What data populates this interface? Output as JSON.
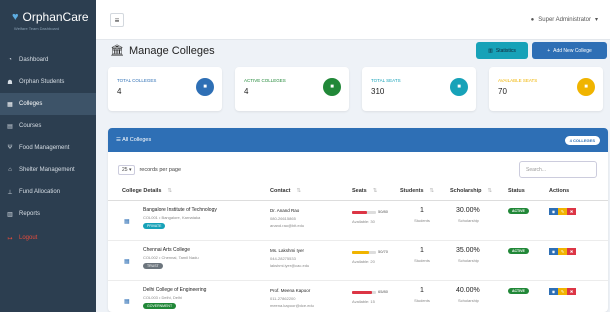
{
  "app": {
    "name": "OrphanCare",
    "subtitle": "Welfare Team Dashboard"
  },
  "sidebar": {
    "items": [
      {
        "label": "Dashboard",
        "icon": "speedometer-icon",
        "glyph": "◔"
      },
      {
        "label": "Orphan Students",
        "icon": "users-icon",
        "glyph": "☗"
      },
      {
        "label": "Colleges",
        "icon": "building-icon",
        "glyph": "▦"
      },
      {
        "label": "Courses",
        "icon": "book-icon",
        "glyph": "▤"
      },
      {
        "label": "Food Management",
        "icon": "utensils-icon",
        "glyph": "Ψ"
      },
      {
        "label": "Shelter Management",
        "icon": "home-icon",
        "glyph": "⌂"
      },
      {
        "label": "Fund Allocation",
        "icon": "hand-coin-icon",
        "glyph": "⊥"
      },
      {
        "label": "Reports",
        "icon": "chart-icon",
        "glyph": "▥"
      }
    ],
    "logout": "Logout"
  },
  "topbar": {
    "user": "Super Administrator"
  },
  "page": {
    "title": "Manage Colleges",
    "stats_button": "Statistics",
    "add_button": "Add New College"
  },
  "cards": [
    {
      "label": "Total Colleges",
      "value": "4",
      "color": "#2e6fb5",
      "label_color": "#2e6fb5",
      "icon": "building-icon"
    },
    {
      "label": "Active Colleges",
      "value": "4",
      "color": "#218838",
      "label_color": "#218838",
      "icon": "check-icon"
    },
    {
      "label": "Total Seats",
      "value": "310",
      "color": "#17a2b8",
      "label_color": "#17a2b8",
      "icon": "chair-icon"
    },
    {
      "label": "Available Seats",
      "value": "70",
      "color": "#f0b400",
      "label_color": "#f0b400",
      "icon": "plus-icon"
    }
  ],
  "table": {
    "title": "All Colleges",
    "count_badge": "4 COLLEGES",
    "per_page": "25",
    "per_page_label": "records per page",
    "search_placeholder": "Search...",
    "headers": [
      "College Details",
      "Contact",
      "Seats",
      "Students",
      "Scholarship",
      "Status",
      "Actions"
    ],
    "rows": [
      {
        "name": "Bangalore Institute of Technology",
        "location": "COL001 • Bangalore, Karnataka",
        "type": "PRIVATE",
        "type_color": "#17a2b8",
        "contact_name": "Dr. Anand Rao",
        "phone": "080-26615865",
        "email": "anand.rao@bit.edu",
        "seats": "50/80",
        "seats_fill": 0.625,
        "bar_color": "#dc3545",
        "available": "Available: 30",
        "students": "1",
        "students_label": "Students",
        "scholarship": "30.00%",
        "scholarship_label": "Scholarship",
        "status": "ACTIVE"
      },
      {
        "name": "Chennai Arts College",
        "location": "COL002 • Chennai, Tamil Nadu",
        "type": "TRUST",
        "type_color": "#6c757d",
        "contact_name": "Ms. Lakshmi Iyer",
        "phone": "044-28275533",
        "email": "lakshmi.iyer@cac.edu",
        "seats": "50/70",
        "seats_fill": 0.714,
        "bar_color": "#f0b400",
        "available": "Available: 20",
        "students": "1",
        "students_label": "Students",
        "scholarship": "35.00%",
        "scholarship_label": "Scholarship",
        "status": "ACTIVE"
      },
      {
        "name": "Delhi College of Engineering",
        "location": "COL003 • Delhi, Delhi",
        "type": "GOVERNMENT",
        "type_color": "#218838",
        "contact_name": "Prof. Meena Kapoor",
        "phone": "011-27862200",
        "email": "meena.kapoor@dce.edu",
        "seats": "65/80",
        "seats_fill": 0.8125,
        "bar_color": "#dc3545",
        "available": "Available: 15",
        "students": "1",
        "students_label": "Students",
        "scholarship": "40.00%",
        "scholarship_label": "Scholarship",
        "status": "ACTIVE"
      }
    ]
  }
}
